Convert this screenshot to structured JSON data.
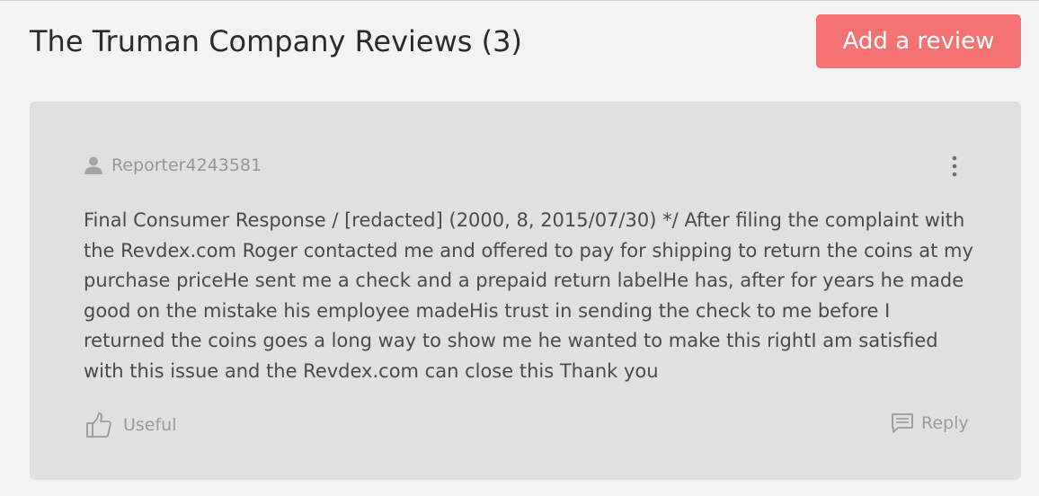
{
  "header": {
    "title": "The Truman Company Reviews (3)",
    "add_review_label": "Add a review"
  },
  "colors": {
    "accent": "#f47272",
    "card_background": "#e0e0e0",
    "page_background": "#f3f3f3"
  },
  "review": {
    "reviewer": "Reporter4243581",
    "text": "Final Consumer Response / [redacted] (2000, 8, 2015/07/30) */ After filing the complaint with the Revdex.com Roger contacted me and offered to pay for shipping to return the coins at my purchase priceHe sent me a check and a prepaid return labelHe has, after for years he made good on the mistake his employee madeHis trust in sending the check to me before I returned the coins goes a long way to show me he wanted to make this rightI am satisfied with this issue and the Revdex.com can close this Thank you",
    "useful_label": "Useful",
    "reply_label": "Reply",
    "icons": {
      "reviewer": "user-icon",
      "menu": "more-vertical-icon",
      "useful": "thumbs-up-icon",
      "reply": "comment-icon"
    }
  }
}
